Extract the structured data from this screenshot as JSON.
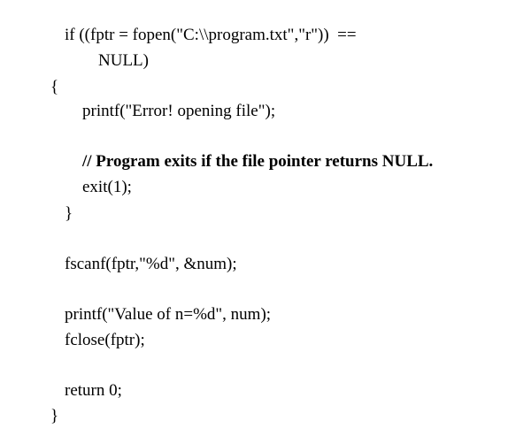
{
  "code": {
    "if_condition_line1": "if ((fptr = fopen(\"C:\\\\program.txt\",\"r\"))  ==",
    "if_condition_line2": "NULL)",
    "open_brace_1": "{",
    "printf_error": "printf(\"Error! opening file\");",
    "comment": "// Program exits if the file pointer returns NULL.",
    "exit_call": "exit(1);",
    "close_brace_1": "}",
    "fscanf_call": "fscanf(fptr,\"%d\", &num);",
    "printf_value": "printf(\"Value of n=%d\", num);",
    "fclose_call": "fclose(fptr);",
    "return_stmt": "return 0;",
    "close_brace_2": "}"
  }
}
